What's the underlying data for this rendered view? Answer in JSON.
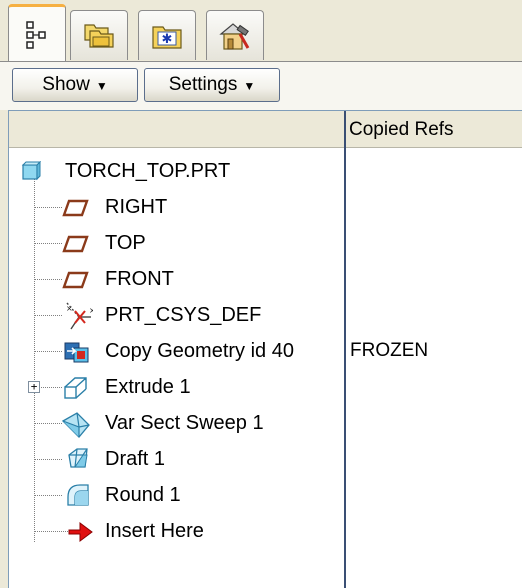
{
  "tabs": [
    {
      "name": "model-tree-tab",
      "icon": "model-tree-icon",
      "active": true
    },
    {
      "name": "folder-browser-tab",
      "icon": "folder-browser-icon",
      "active": false
    },
    {
      "name": "favorites-tab",
      "icon": "favorites-folder-icon",
      "active": false
    },
    {
      "name": "tools-tab",
      "icon": "tools-hammer-icon",
      "active": false
    }
  ],
  "toolbar": {
    "show_label": "Show",
    "settings_label": "Settings"
  },
  "tree": {
    "column_header": "Copied Refs",
    "root": {
      "label": "TORCH_TOP.PRT",
      "icon": "part-icon"
    },
    "items": [
      {
        "label": "RIGHT",
        "icon": "datum-plane-icon",
        "copied_refs": ""
      },
      {
        "label": "TOP",
        "icon": "datum-plane-icon",
        "copied_refs": ""
      },
      {
        "label": "FRONT",
        "icon": "datum-plane-icon",
        "copied_refs": ""
      },
      {
        "label": "PRT_CSYS_DEF",
        "icon": "coordinate-system-icon",
        "copied_refs": ""
      },
      {
        "label": "Copy Geometry id 40",
        "icon": "copy-geometry-icon",
        "copied_refs": "FROZEN"
      },
      {
        "label": "Extrude 1",
        "icon": "extrude-icon",
        "copied_refs": "",
        "expandable": true
      },
      {
        "label": "Var Sect Sweep 1",
        "icon": "sweep-icon",
        "copied_refs": ""
      },
      {
        "label": "Draft 1",
        "icon": "draft-icon",
        "copied_refs": ""
      },
      {
        "label": "Round 1",
        "icon": "round-icon",
        "copied_refs": ""
      },
      {
        "label": "Insert Here",
        "icon": "insert-arrow-icon",
        "copied_refs": ""
      }
    ]
  },
  "colors": {
    "accent_tab": "#f6b042",
    "panel_border": "#7f9db9",
    "datum_plane": "#8b3a1a",
    "insert_arrow": "#e01010"
  }
}
